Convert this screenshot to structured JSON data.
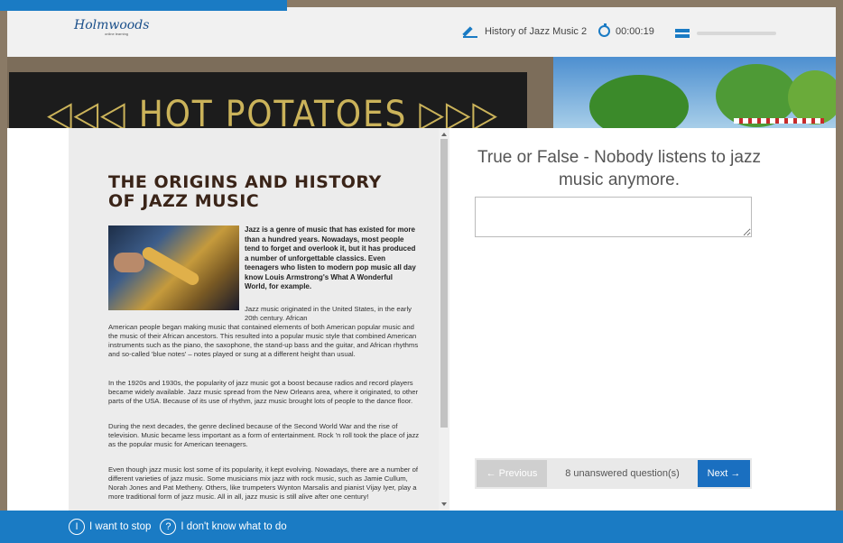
{
  "header": {
    "logo_text": "Holmwoods",
    "logo_subtext": "online learning",
    "test_title": "History of Jazz Music 2",
    "timer": "00:00:19",
    "progress_fraction": 0.0
  },
  "banner": {
    "text": "◁◁◁ HOT POTATOES ▷▷▷"
  },
  "article": {
    "title": "THE ORIGINS AND HISTORY OF JAZZ MUSIC",
    "intro": "Jazz is a genre of music that has existed for more than a hundred years. Nowadays, most people tend to forget and overlook it, but it has produced a number of unforgettable classics. Even teenagers who listen to modern pop music all day know Louis Armstrong's What A Wonderful World, for example.",
    "para1_start": "Jazz music originated in the United States, in the early 20th century. African",
    "para1_rest": "American people began making music that contained elements of both American popular music and the music of their African ancestors. This resulted into a popular music style that combined American instruments such as the piano, the saxophone, the stand-up bass and the guitar, and African rhythms and so-called 'blue notes' – notes played or sung at a different height than usual.",
    "para2": "In the 1920s and 1930s, the popularity of jazz music got a boost because radios and record players became widely available. Jazz music spread from the New Orleans area, where it originated, to other parts of the USA. Because of its use of rhythm, jazz music brought lots of people to the dance floor.",
    "para3": "During the next decades, the genre declined because of the Second World War and the rise of television. Music became less important as a form of entertainment. Rock 'n roll took the place of jazz as the popular music for American teenagers.",
    "para4": "Even though jazz music lost some of its popularity, it kept evolving. Nowadays, there are a number of different varieties of jazz music. Some musicians mix jazz with rock music, such as Jamie Cullum, Norah Jones and Pat Metheny. Others, like trumpeters Wynton Marsalis and pianist Vijay Iyer, play a more traditional form of jazz music. All in all, jazz music is still alive after one century!"
  },
  "question": {
    "text": "True or False - Nobody listens to jazz music anymore.",
    "answer_value": ""
  },
  "navigation": {
    "prev_label": "← Previous",
    "unanswered_label": "8 unanswered question(s)",
    "next_label": "Next →"
  },
  "footer": {
    "stop_icon": "I",
    "stop_label": "I want to stop",
    "dontknow_icon": "?",
    "dontknow_label": "I don't know what to do"
  },
  "colors": {
    "brand_blue": "#1a7bc4",
    "next_button": "#1a6fc0",
    "title_brown": "#3a2418"
  }
}
